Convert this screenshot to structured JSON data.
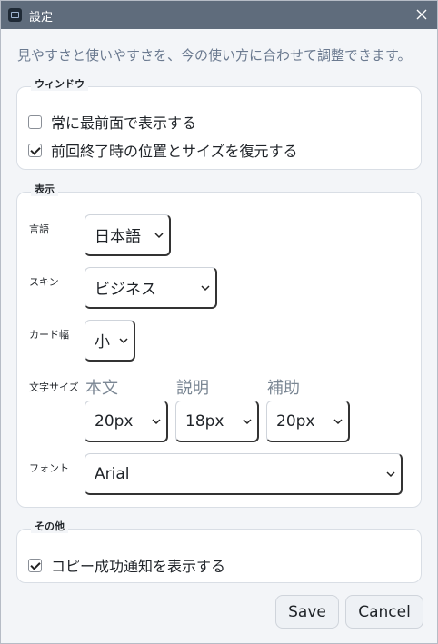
{
  "window": {
    "title": "設定",
    "intro": "見やすさと使いやすさを、今の使い方に合わせて調整できます。"
  },
  "sections": {
    "window": {
      "legend": "ウィンドウ",
      "always_on_top": {
        "label": "常に最前面で表示する",
        "checked": false
      },
      "restore_position": {
        "label": "前回終了時の位置とサイズを復元する",
        "checked": true
      }
    },
    "display": {
      "legend": "表示",
      "language": {
        "label": "言語",
        "value": "日本語"
      },
      "skin": {
        "label": "スキン",
        "value": "ビジネス"
      },
      "card_width": {
        "label": "カード幅",
        "value": "小"
      },
      "font_size": {
        "label": "文字サイズ",
        "body": {
          "label": "本文",
          "value": "20px"
        },
        "description": {
          "label": "説明",
          "value": "18px"
        },
        "auxiliary": {
          "label": "補助",
          "value": "20px"
        }
      },
      "font": {
        "label": "フォント",
        "value": "Arial"
      }
    },
    "other": {
      "legend": "その他",
      "copy_notify": {
        "label": "コピー成功通知を表示する",
        "checked": true
      }
    }
  },
  "buttons": {
    "save": "Save",
    "cancel": "Cancel"
  },
  "icons": {
    "app": "app-icon",
    "close": "close-icon",
    "dropdown": "chevron-down-icon"
  },
  "colors": {
    "titlebar": "#5f6c7c",
    "background": "#f3f5f8",
    "intro_text": "#6b7a90"
  }
}
